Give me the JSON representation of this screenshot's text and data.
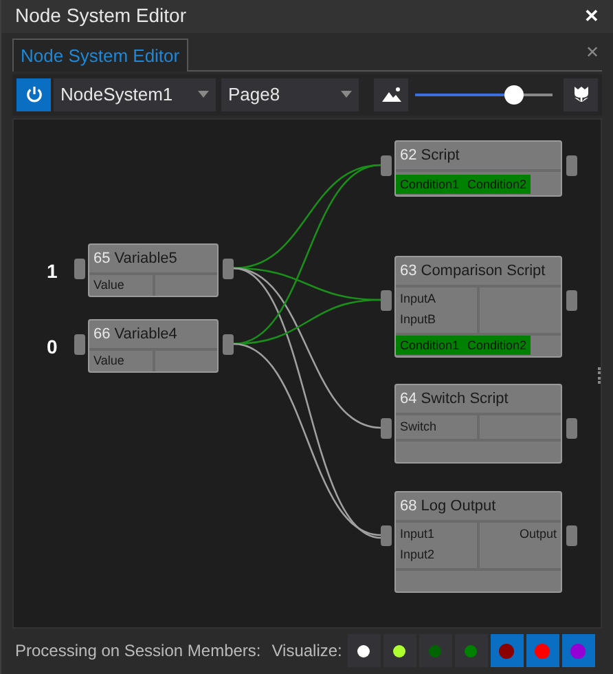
{
  "window": {
    "title": "Node System Editor",
    "close": "✕"
  },
  "tabs": [
    {
      "label": "Node System Editor",
      "selected": true
    }
  ],
  "tab_close": "✕",
  "toolbar": {
    "power_on": true,
    "system": "NodeSystem1",
    "page": "Page8",
    "zoom": {
      "level": 0.72
    }
  },
  "canvas": {
    "nodes": [
      {
        "kind": "script",
        "id": "62",
        "title": "Script",
        "conditions": [
          "Condition1",
          "Condition2"
        ]
      },
      {
        "kind": "script",
        "id": "63",
        "title": "Comparison Script",
        "inputs": [
          "InputA",
          "InputB"
        ],
        "conditions": [
          "Condition1",
          "Condition2"
        ]
      },
      {
        "kind": "script",
        "id": "64",
        "title": "Switch Script",
        "inputs": [
          "Switch"
        ]
      },
      {
        "kind": "script",
        "id": "68",
        "title": "Log Output",
        "inputs": [
          "Input1",
          "Input2"
        ],
        "outputs": [
          "Output"
        ]
      },
      {
        "kind": "variable",
        "id": "65",
        "title": "Variable5",
        "value": "1",
        "inputs": [
          "Value"
        ],
        "links": [
          {
            "active": true
          },
          {
            "active": true
          },
          {
            "active": false
          },
          {
            "active": false
          }
        ]
      },
      {
        "kind": "variable",
        "id": "66",
        "title": "Variable4",
        "value": "0",
        "inputs": [
          "Value"
        ],
        "links": [
          {
            "active": true
          },
          {
            "active": true
          },
          {
            "active": false
          }
        ]
      }
    ]
  },
  "status_bar": {
    "label": "Processing on Session Members:",
    "visualize_label": "Visualize:",
    "toggles": [
      {
        "color": "#ffffff",
        "selected": false
      },
      {
        "color": "#adff2f",
        "selected": false
      },
      {
        "color": "#006400",
        "selected": false
      },
      {
        "color": "#008000",
        "selected": false
      },
      {
        "color": "#8b0000",
        "selected": true
      },
      {
        "color": "#ff0000",
        "selected": true
      },
      {
        "color": "#9400d3",
        "selected": true
      }
    ]
  }
}
